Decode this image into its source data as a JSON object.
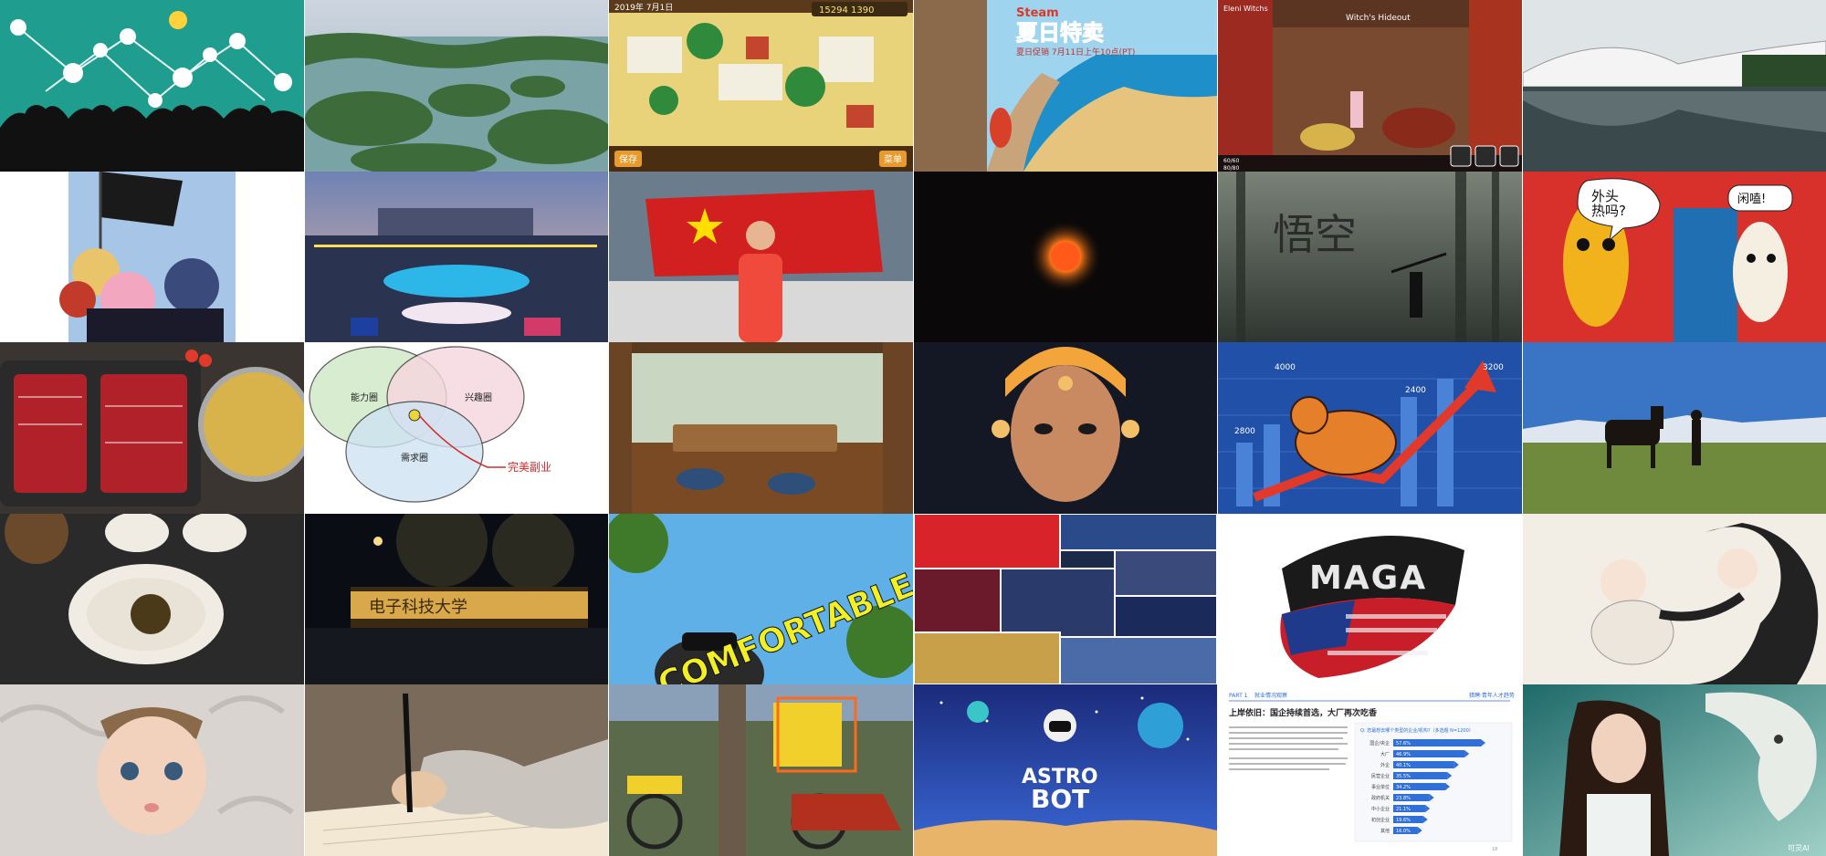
{
  "grid": {
    "columns": 6,
    "rows": 5
  },
  "tiles": [
    {
      "id": "r1c1",
      "name": "network-silhouettes-illustration",
      "colors": {
        "bg": "#1f9e8f",
        "fg": "#111111"
      }
    },
    {
      "id": "r1c2",
      "name": "aerial-lake-islands-photo",
      "colors": {
        "sky": "#b8c7d8",
        "water": "#7fa6a8",
        "land": "#3d6b3a"
      }
    },
    {
      "id": "r1c3",
      "name": "pixel-park-game-screenshot",
      "texts": {
        "date": "2019年 7月1日",
        "money": "15294 1390",
        "save": "保存",
        "menu": "菜单"
      }
    },
    {
      "id": "r1c4",
      "name": "steam-summer-sale-banner",
      "texts": {
        "brand": "Steam",
        "title": "夏日特卖",
        "date": "夏日促销 7月11日上午10点(PT)"
      }
    },
    {
      "id": "r1c5",
      "name": "witch-hideout-game-screenshot",
      "texts": {
        "corner": "Eleni Witchs",
        "place": "Witch's Hideout",
        "hp1": "60/60",
        "hp2": "80/80"
      }
    },
    {
      "id": "r1c6",
      "name": "modern-building-reflection-photo",
      "colors": {
        "sky": "#dfe4e6",
        "water": "#3a4a4c"
      }
    },
    {
      "id": "r2c1",
      "name": "anime-girls-flag-illustration",
      "colors": {
        "bg": "#ffffff",
        "panel": "#a7c5e6"
      }
    },
    {
      "id": "r2c2",
      "name": "stadium-ceremony-photo",
      "colors": {
        "sky": "#8fa1c7",
        "ground": "#2a3350"
      }
    },
    {
      "id": "r2c3",
      "name": "athlete-with-flag-photo",
      "colors": {
        "flag": "#d21f1f",
        "star": "#ffde00",
        "shirt": "#f04a3c"
      }
    },
    {
      "id": "r2c4",
      "name": "glowing-orb-dark-photo",
      "colors": {
        "bg": "#0a0808",
        "glow": "#ff7a1a"
      }
    },
    {
      "id": "r2c5",
      "name": "wukong-foggy-forest-artwork",
      "texts": {
        "calligraphy": "悟空"
      }
    },
    {
      "id": "r2c6",
      "name": "corn-characters-illustration",
      "texts": {
        "bubble_left": "外头\n热吗?",
        "bubble_right": "闲嗑!"
      }
    },
    {
      "id": "r3c1",
      "name": "hotpot-meat-platters-photo",
      "colors": {
        "meat": "#b0212a",
        "broth": "#d8b24a"
      }
    },
    {
      "id": "r3c2",
      "name": "venn-diagram",
      "texts": {
        "circle_a": "能力圈",
        "circle_b": "兴趣圈",
        "circle_c": "需求圈",
        "callout": "完美副业"
      }
    },
    {
      "id": "r3c3",
      "name": "tearoom-interior-photo",
      "colors": {
        "wood": "#7a4a25",
        "cushion": "#2d4f7a"
      }
    },
    {
      "id": "r3c4",
      "name": "cyborg-portrait-art",
      "colors": {
        "bg": "#141824",
        "glow": "#f3a53b"
      }
    },
    {
      "id": "r3c5",
      "name": "bull-market-chart-illustration",
      "texts": {
        "v1": "4000",
        "v2": "3200",
        "v3": "2400",
        "v4": "2800"
      }
    },
    {
      "id": "r3c6",
      "name": "horse-grassland-photo",
      "colors": {
        "sky": "#3a74c4",
        "grass": "#6f8a3c"
      }
    },
    {
      "id": "r4c1",
      "name": "tea-bowl-closeup-photo",
      "colors": {
        "bg": "#2a2a2a",
        "bowl": "#f1ece3"
      }
    },
    {
      "id": "r4c2",
      "name": "university-gate-night-photo",
      "texts": {
        "sign": "电子科技大学"
      }
    },
    {
      "id": "r4c3",
      "name": "comfortable-selfie-photo",
      "texts": {
        "word": "COMFORTABLE"
      }
    },
    {
      "id": "r4c4",
      "name": "esports-collage-photo",
      "colors": {
        "bg": "#1c2a4a",
        "red": "#d8232a"
      }
    },
    {
      "id": "r4c5",
      "name": "maga-rhinestone-visor-photo",
      "texts": {
        "hat": "MAGA"
      }
    },
    {
      "id": "r4c6",
      "name": "ink-mother-baby-painting",
      "colors": {
        "paper": "#f2eee6",
        "ink": "#222222"
      }
    },
    {
      "id": "r5c1",
      "name": "baby-portrait-art",
      "colors": {
        "bg": "#d9d4cf",
        "skin": "#f3d2bd"
      }
    },
    {
      "id": "r5c2",
      "name": "handwriting-notebook-photo",
      "colors": {
        "paper": "#f2e8d3",
        "sleeve": "#c9c4bd"
      }
    },
    {
      "id": "r5c3",
      "name": "bicycle-yellow-box-photo",
      "colors": {
        "box": "#f2d02c",
        "outline": "#ff6a1a"
      }
    },
    {
      "id": "r5c4",
      "name": "astro-bot-game-art",
      "texts": {
        "line1": "ASTRO",
        "line2": "BOT"
      }
    },
    {
      "id": "r5c5",
      "name": "report-slide-bar-chart",
      "texts": {
        "part": "PART 1",
        "section": "就业情况观察",
        "brand": "猎聘·青年人才趋势",
        "title": "上岸依旧：国企持续首选，大厂再次吃香",
        "question": "Q: 您最想去哪个类型的企业/机构?（多选题 N=1200）",
        "footer": "18"
      }
    },
    {
      "id": "r5c6",
      "name": "girl-and-dragon-art",
      "texts": {
        "watermark": "可灵AI"
      }
    }
  ],
  "chart_data": [
    {
      "type": "bar",
      "title": "",
      "categories": [
        "国企/央企",
        "大厂",
        "外企",
        "民营企业",
        "事业单位",
        "政府机关",
        "中小企业",
        "初创企业",
        "其他"
      ],
      "values": [
        57.6,
        46.9,
        40.1,
        35.5,
        34.2,
        23.8,
        21.1,
        19.6,
        16.0
      ],
      "labels": [
        "57.6%",
        "46.9%",
        "40.1%",
        "35.5%",
        "34.2%",
        "23.8%",
        "21.1%",
        "19.6%",
        "16.0%"
      ],
      "xlabel": "",
      "ylabel": "",
      "xlim": [
        0,
        60
      ],
      "colors": {
        "bar": "#2f6fd6"
      }
    }
  ]
}
